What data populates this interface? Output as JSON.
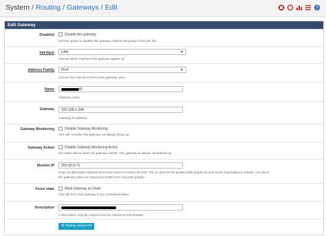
{
  "breadcrumb": [
    "System",
    "Routing",
    "Gateways",
    "Edit"
  ],
  "toolbar_icons": [
    "stop-icon",
    "restart-icon",
    "chart-icon",
    "list-icon",
    "help-icon"
  ],
  "panel": {
    "title": "Edit Gateway"
  },
  "fields": {
    "disabled": {
      "label": "Disabled",
      "checkbox": "Disable this gateway",
      "help": "Set this option to disable this gateway without removing it from the list."
    },
    "interface": {
      "label": "Interface",
      "value": "LAN",
      "help": "Choose which interface this gateway applies to."
    },
    "address_family": {
      "label": "Address Family",
      "value": "IPv4",
      "help": "Choose the Internet Protocol this gateway uses."
    },
    "name": {
      "label": "Name",
      "value_suffix": "W",
      "help": "Gateway name"
    },
    "gateway": {
      "label": "Gateway",
      "value": "192.168.1.246",
      "help": "Gateway IP address"
    },
    "monitoring": {
      "label": "Gateway Monitoring",
      "checkbox": "Disable Gateway Monitoring",
      "help": "This will consider this gateway as always being up."
    },
    "action": {
      "label": "Gateway Action",
      "checkbox": "Disable Gateway Monitoring Action",
      "help": "No action will be taken on gateway events. The gateway is always considered up."
    },
    "monitor_ip": {
      "label": "Monitor IP",
      "value": "202.60.9.71",
      "help1": "Enter an alternative address here to be used to monitor the link. This is used for the quality RRD graphs as well as the load balancer entries. Use this if",
      "help2": "the gateway does not respond to ICMP echo requests (pings)."
    },
    "force_state": {
      "label": "Force state",
      "checkbox": "Mark Gateway as Down",
      "help": "This will force this gateway to be considered down."
    },
    "description": {
      "label": "Description",
      "help": "A description may be entered here for reference (not parsed)."
    }
  },
  "advanced_button": "Display Advanced",
  "colors": {
    "header": "#334b6c",
    "link": "#2a6fba",
    "button": "#1ba1c9"
  }
}
